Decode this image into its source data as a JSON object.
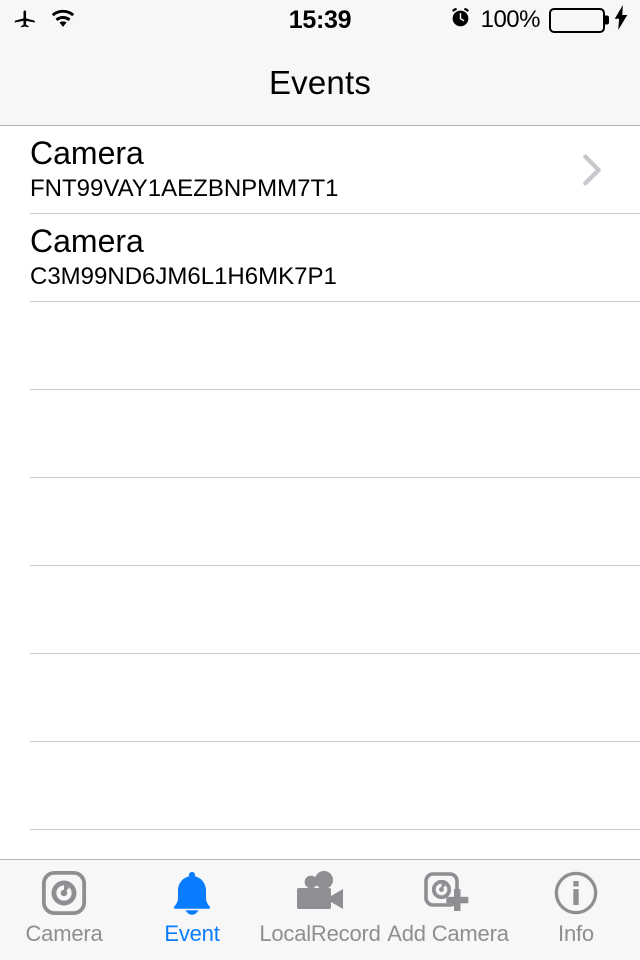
{
  "status_bar": {
    "airplane_icon": "airplane-icon",
    "wifi_icon": "wifi-icon",
    "time": "15:39",
    "alarm_icon": "alarm-clock-icon",
    "battery_percent": "100%",
    "battery_level": 100,
    "battery_color": "#4cd964",
    "charging_icon": "lightning-bolt-icon"
  },
  "nav_bar": {
    "title": "Events"
  },
  "list": {
    "rows": [
      {
        "title": "Camera",
        "subtitle": "FNT99VAY1AEZBNPMM7T1",
        "has_chevron": true
      },
      {
        "title": "Camera",
        "subtitle": "C3M99ND6JM6L1H6MK7P1",
        "has_chevron": false
      }
    ],
    "empty_row_count": 7
  },
  "tab_bar": {
    "active_color": "#0a7cff",
    "inactive_color": "#8e8e93",
    "tabs": [
      {
        "label": "Camera",
        "icon": "camera-icon",
        "active": false
      },
      {
        "label": "Event",
        "icon": "bell-icon",
        "active": true
      },
      {
        "label": "LocalRecord",
        "icon": "camcorder-icon",
        "active": false
      },
      {
        "label": "Add Camera",
        "icon": "add-camera-icon",
        "active": false
      },
      {
        "label": "Info",
        "icon": "info-circle-icon",
        "active": false
      }
    ]
  }
}
